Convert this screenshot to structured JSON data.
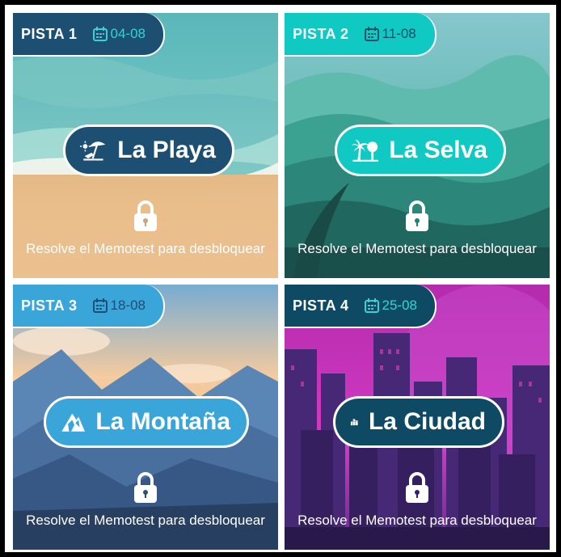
{
  "cards": [
    {
      "pista": "PISTA 1",
      "date": "04-08",
      "title": "La Playa",
      "hint": "Resolve el Memotest para desbloquear",
      "icon": "beach-umbrella-icon",
      "accent": "#1d4f73",
      "date_color": "#3bd1d1"
    },
    {
      "pista": "PISTA 2",
      "date": "11-08",
      "title": "La Selva",
      "hint": "Resolve el Memotest para desbloquear",
      "icon": "palm-tree-icon",
      "accent": "#10c9c2",
      "date_color": "#0d4f6b"
    },
    {
      "pista": "PISTA 3",
      "date": "18-08",
      "title": "La Montaña",
      "hint": "Resolve el Memotest para desbloquear",
      "icon": "mountain-icon",
      "accent": "#3aa5d9",
      "date_color": "#1d4f73"
    },
    {
      "pista": "PISTA 4",
      "date": "25-08",
      "title": "La Ciudad",
      "hint": "Resolve el Memotest para desbloquear",
      "icon": "city-buildings-icon",
      "accent": "#0e4a63",
      "date_color": "#3bd1d1"
    }
  ]
}
